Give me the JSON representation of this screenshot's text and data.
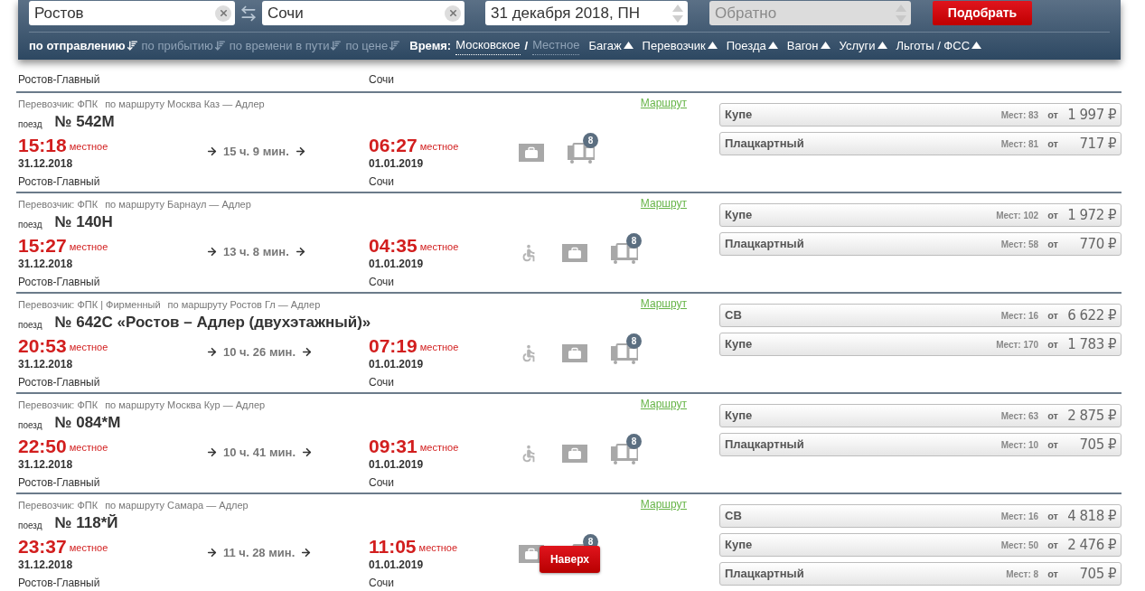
{
  "search": {
    "from": "Ростов",
    "to": "Сочи",
    "date": "31 декабря 2018, ПН",
    "return_placeholder": "Обратно",
    "return_disabled": true,
    "submit": "Подобрать"
  },
  "sort": [
    {
      "label": "по отправлению",
      "selected": true
    },
    {
      "label": "по прибытию",
      "selected": false
    },
    {
      "label": "по времени в пути",
      "selected": false
    },
    {
      "label": "по цене",
      "selected": false
    }
  ],
  "time": {
    "label": "Время:",
    "separator": "/",
    "options": [
      {
        "label": "Московское",
        "selected": true
      },
      {
        "label": "Местное",
        "selected": false
      }
    ]
  },
  "filters": [
    "Багаж",
    "Перевозчик",
    "Поезда",
    "Вагон",
    "Услуги",
    "Льготы / ФСС"
  ],
  "previous_row": {
    "departure_station": "Ростов-Главный",
    "arrival_station": "Сочи"
  },
  "trains": [
    {
      "carrier": "Перевозчик: ФПК",
      "route": "по маршруту Москва Каз — Адлер",
      "route_link": "Маршрут",
      "train_label": "поезд",
      "number": "№ 542М",
      "departure_time": "15:18",
      "departure_tz": "местное",
      "departure_date": "31.12.2018",
      "departure_station": "Ростов-Главный",
      "duration": "15 ч. 9 мин.",
      "arrival_time": "06:27",
      "arrival_tz": "местное",
      "arrival_date": "01.01.2019",
      "arrival_station": "Сочи",
      "services": [
        {
          "kind": "luggage"
        },
        {
          "kind": "cargo",
          "badge": "8"
        }
      ],
      "fares": [
        {
          "class": "Купе",
          "seats": "Мест: 83",
          "from": "от",
          "price": "1 997 ₽"
        },
        {
          "class": "Плацкартный",
          "seats": "Мест: 81",
          "from": "от",
          "price": "717 ₽"
        }
      ]
    },
    {
      "carrier": "Перевозчик: ФПК",
      "route": "по маршруту Барнаул — Адлер",
      "route_link": "Маршрут",
      "train_label": "поезд",
      "number": "№ 140Н",
      "departure_time": "15:27",
      "departure_tz": "местное",
      "departure_date": "31.12.2018",
      "departure_station": "Ростов-Главный",
      "duration": "13 ч. 8 мин.",
      "arrival_time": "04:35",
      "arrival_tz": "местное",
      "arrival_date": "01.01.2019",
      "arrival_station": "Сочи",
      "services": [
        {
          "kind": "wheelchair"
        },
        {
          "kind": "luggage"
        },
        {
          "kind": "cargo",
          "badge": "8"
        }
      ],
      "fares": [
        {
          "class": "Купе",
          "seats": "Мест: 102",
          "from": "от",
          "price": "1 972 ₽"
        },
        {
          "class": "Плацкартный",
          "seats": "Мест: 58",
          "from": "от",
          "price": "770 ₽"
        }
      ]
    },
    {
      "carrier": "Перевозчик: ФПК | Фирменный",
      "route": "по маршруту Ростов Гл — Адлер",
      "route_link": "Маршрут",
      "train_label": "поезд",
      "number": "№ 642С «Ростов – Адлер (двухэтажный)»",
      "departure_time": "20:53",
      "departure_tz": "местное",
      "departure_date": "31.12.2018",
      "departure_station": "Ростов-Главный",
      "duration": "10 ч. 26 мин.",
      "arrival_time": "07:19",
      "arrival_tz": "местное",
      "arrival_date": "01.01.2019",
      "arrival_station": "Сочи",
      "services": [
        {
          "kind": "wheelchair"
        },
        {
          "kind": "luggage"
        },
        {
          "kind": "cargo",
          "badge": "8"
        }
      ],
      "fares": [
        {
          "class": "СВ",
          "seats": "Мест: 16",
          "from": "от",
          "price": "6 622 ₽"
        },
        {
          "class": "Купе",
          "seats": "Мест: 170",
          "from": "от",
          "price": "1 783 ₽"
        }
      ]
    },
    {
      "carrier": "Перевозчик: ФПК",
      "route": "по маршруту Москва Кур — Адлер",
      "route_link": "Маршрут",
      "train_label": "поезд",
      "number": "№ 084*М",
      "departure_time": "22:50",
      "departure_tz": "местное",
      "departure_date": "31.12.2018",
      "departure_station": "Ростов-Главный",
      "duration": "10 ч. 41 мин.",
      "arrival_time": "09:31",
      "arrival_tz": "местное",
      "arrival_date": "01.01.2019",
      "arrival_station": "Сочи",
      "services": [
        {
          "kind": "wheelchair"
        },
        {
          "kind": "luggage"
        },
        {
          "kind": "cargo",
          "badge": "8"
        }
      ],
      "fares": [
        {
          "class": "Купе",
          "seats": "Мест: 63",
          "from": "от",
          "price": "2 875 ₽"
        },
        {
          "class": "Плацкартный",
          "seats": "Мест: 10",
          "from": "от",
          "price": "705 ₽"
        }
      ]
    },
    {
      "carrier": "Перевозчик: ФПК",
      "route": "по маршруту Самара — Адлер",
      "route_link": "Маршрут",
      "train_label": "поезд",
      "number": "№ 118*Й",
      "departure_time": "23:37",
      "departure_tz": "местное",
      "departure_date": "31.12.2018",
      "departure_station": "Ростов-Главный",
      "duration": "11 ч. 28 мин.",
      "arrival_time": "11:05",
      "arrival_tz": "местное",
      "arrival_date": "01.01.2019",
      "arrival_station": "Сочи",
      "services": [
        {
          "kind": "luggage"
        },
        {
          "kind": "cargo",
          "badge": "8"
        }
      ],
      "fares": [
        {
          "class": "СВ",
          "seats": "Мест: 16",
          "from": "от",
          "price": "4 818 ₽"
        },
        {
          "class": "Купе",
          "seats": "Мест: 50",
          "from": "от",
          "price": "2 476 ₽"
        },
        {
          "class": "Плацкартный",
          "seats": "Мест: 8",
          "from": "от",
          "price": "705 ₽"
        }
      ]
    }
  ],
  "scroll_top_button": "Наверх"
}
